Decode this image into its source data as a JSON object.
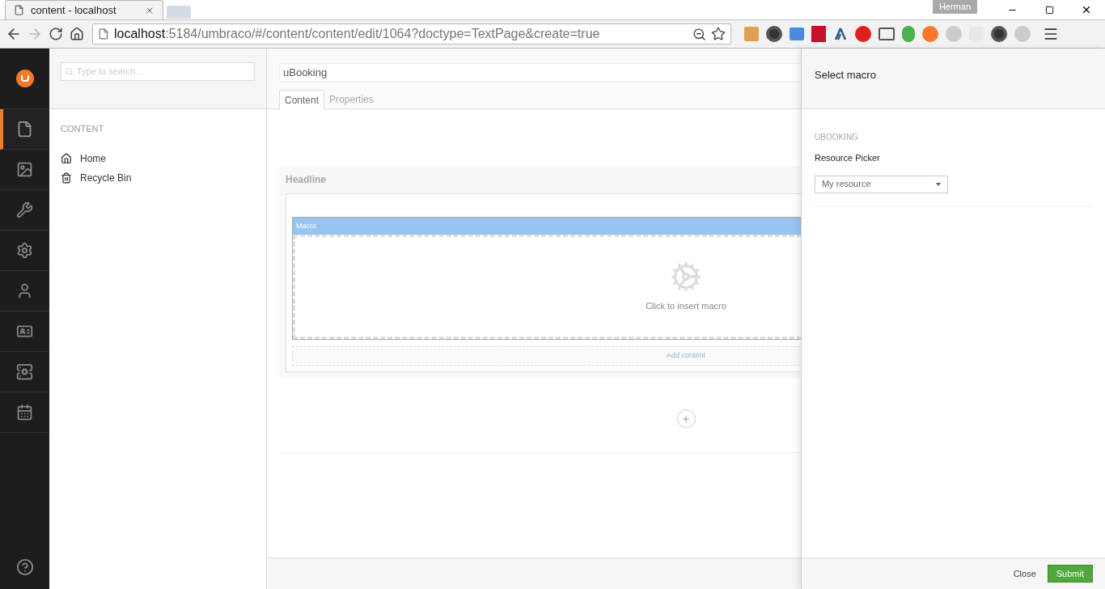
{
  "browser": {
    "tab_title": "content - localhost",
    "profile": "Herman",
    "url_host": "localhost",
    "url_rest": ":5184/umbraco/#/content/content/edit/1064?doctype=TextPage&create=true"
  },
  "sections": [
    {
      "selected": true
    },
    {
      "selected": false
    },
    {
      "selected": false
    },
    {
      "selected": false
    },
    {
      "selected": false
    },
    {
      "selected": false
    },
    {
      "selected": false
    },
    {
      "selected": false
    }
  ],
  "tree": {
    "search_placeholder": "Type to search...",
    "heading": "CONTENT",
    "items": [
      {
        "label": "Home"
      },
      {
        "label": "Recycle Bin"
      }
    ]
  },
  "editor": {
    "name_value": "uBooking",
    "tabs": [
      {
        "label": "Content",
        "selected": true
      },
      {
        "label": "Properties",
        "selected": false
      }
    ],
    "headline": "Headline",
    "macro_label": "Macro",
    "insert_text": "Click to insert macro",
    "add_content": "Add content"
  },
  "overlay": {
    "title": "Select macro",
    "group": "UBOOKING",
    "field_label": "Resource Picker",
    "select_value": "My resource",
    "close": "Close",
    "submit": "Submit"
  }
}
